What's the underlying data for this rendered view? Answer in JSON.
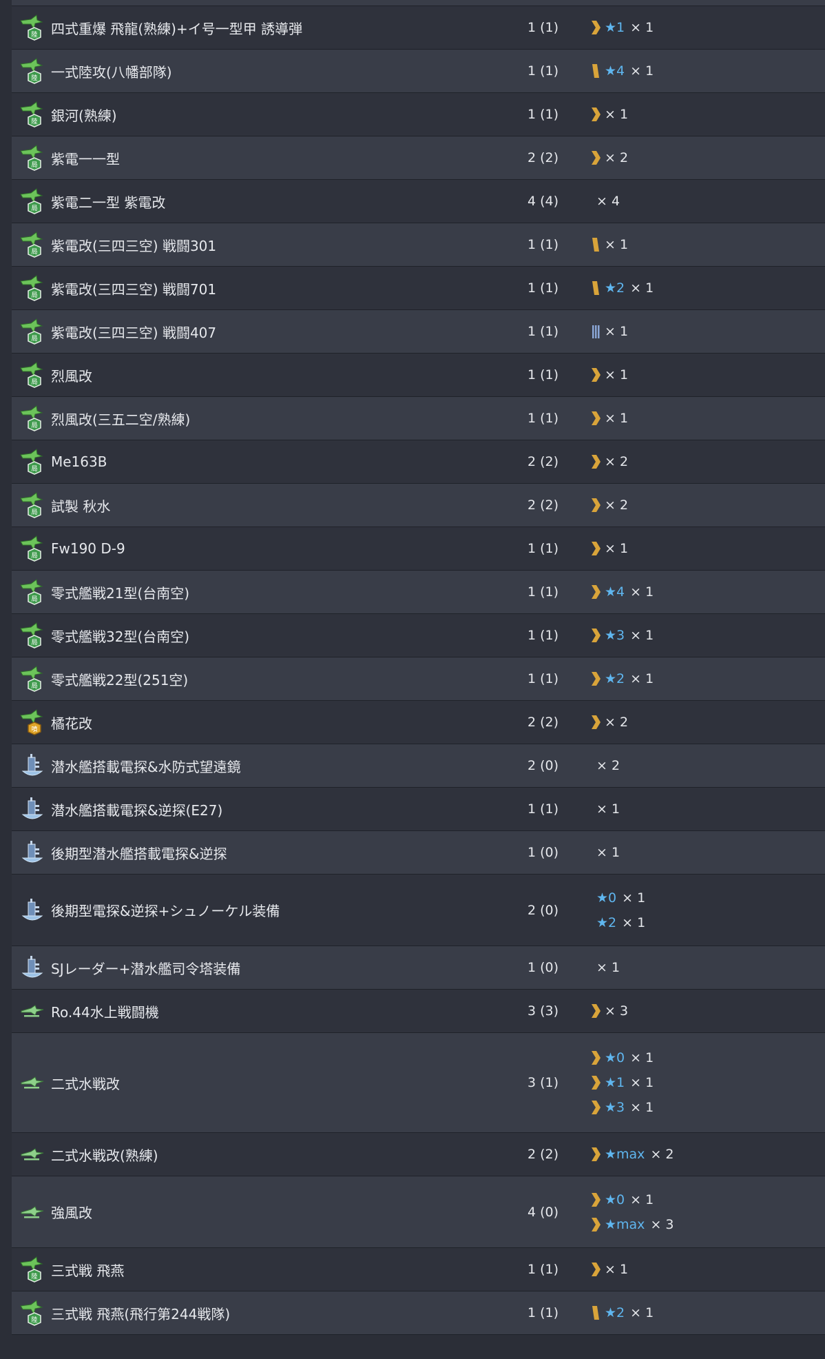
{
  "colors": {
    "row_odd": "#393d48",
    "row_even": "#2f323c",
    "star": "#5fb6ef",
    "proficiency_gold": "#d9a43a",
    "proficiency_blue": "#8aa6d6"
  },
  "rows": [
    {
      "name": "四式重爆 飛龍(熟練)+イ号一型甲 誘導弾",
      "icon": "land-attacker-icon",
      "count": "1 (1)",
      "prof": [
        {
          "icon": "proficiency-chevron-icon",
          "star": "★1",
          "qty": "× 1"
        }
      ]
    },
    {
      "name": "一式陸攻(八幡部隊)",
      "icon": "land-attacker-icon",
      "count": "1 (1)",
      "prof": [
        {
          "icon": "proficiency-bar-icon",
          "star": "★4",
          "qty": "× 1"
        }
      ]
    },
    {
      "name": "銀河(熟練)",
      "icon": "land-attacker-icon",
      "count": "1 (1)",
      "prof": [
        {
          "icon": "proficiency-chevron-icon",
          "star": "",
          "qty": "× 1"
        }
      ]
    },
    {
      "name": "紫電一一型",
      "icon": "interceptor-icon",
      "count": "2 (2)",
      "prof": [
        {
          "icon": "proficiency-chevron-icon",
          "star": "",
          "qty": "× 2"
        }
      ]
    },
    {
      "name": "紫電二一型 紫電改",
      "icon": "interceptor-icon",
      "count": "4 (4)",
      "prof": [
        {
          "icon": "none",
          "star": "",
          "qty": "× 4"
        }
      ]
    },
    {
      "name": "紫電改(三四三空) 戦闘301",
      "icon": "interceptor-icon",
      "count": "1 (1)",
      "prof": [
        {
          "icon": "proficiency-bar-icon",
          "star": "",
          "qty": "× 1"
        }
      ]
    },
    {
      "name": "紫電改(三四三空) 戦闘701",
      "icon": "interceptor-icon",
      "count": "1 (1)",
      "prof": [
        {
          "icon": "proficiency-bar-icon",
          "star": "★2",
          "qty": "× 1"
        }
      ]
    },
    {
      "name": "紫電改(三四三空) 戦闘407",
      "icon": "interceptor-icon",
      "count": "1 (1)",
      "prof": [
        {
          "icon": "proficiency-blue-bars-icon",
          "star": "",
          "qty": "× 1"
        }
      ]
    },
    {
      "name": "烈風改",
      "icon": "interceptor-icon",
      "count": "1 (1)",
      "prof": [
        {
          "icon": "proficiency-chevron-icon",
          "star": "",
          "qty": "× 1"
        }
      ]
    },
    {
      "name": "烈風改(三五二空/熟練)",
      "icon": "interceptor-icon",
      "count": "1 (1)",
      "prof": [
        {
          "icon": "proficiency-chevron-icon",
          "star": "",
          "qty": "× 1"
        }
      ]
    },
    {
      "name": "Me163B",
      "icon": "interceptor-icon",
      "count": "2 (2)",
      "prof": [
        {
          "icon": "proficiency-chevron-icon",
          "star": "",
          "qty": "× 2"
        }
      ]
    },
    {
      "name": "試製 秋水",
      "icon": "interceptor-icon",
      "count": "2 (2)",
      "prof": [
        {
          "icon": "proficiency-chevron-icon",
          "star": "",
          "qty": "× 2"
        }
      ]
    },
    {
      "name": "Fw190 D-9",
      "icon": "interceptor-icon",
      "count": "1 (1)",
      "prof": [
        {
          "icon": "proficiency-chevron-icon",
          "star": "",
          "qty": "× 1"
        }
      ]
    },
    {
      "name": "零式艦戦21型(台南空)",
      "icon": "interceptor-icon",
      "count": "1 (1)",
      "prof": [
        {
          "icon": "proficiency-chevron-icon",
          "star": "★4",
          "qty": "× 1"
        }
      ]
    },
    {
      "name": "零式艦戦32型(台南空)",
      "icon": "interceptor-icon",
      "count": "1 (1)",
      "prof": [
        {
          "icon": "proficiency-chevron-icon",
          "star": "★3",
          "qty": "× 1"
        }
      ]
    },
    {
      "name": "零式艦戦22型(251空)",
      "icon": "interceptor-icon",
      "count": "1 (1)",
      "prof": [
        {
          "icon": "proficiency-chevron-icon",
          "star": "★2",
          "qty": "× 1"
        }
      ]
    },
    {
      "name": "橘花改",
      "icon": "jet-bomber-icon",
      "count": "2 (2)",
      "prof": [
        {
          "icon": "proficiency-chevron-icon",
          "star": "",
          "qty": "× 2"
        }
      ]
    },
    {
      "name": "潜水艦搭載電探&水防式望遠鏡",
      "icon": "submarine-equipment-icon",
      "count": "2 (0)",
      "prof": [
        {
          "icon": "none",
          "star": "",
          "qty": "× 2"
        }
      ]
    },
    {
      "name": "潜水艦搭載電探&逆探(E27)",
      "icon": "submarine-equipment-icon",
      "count": "1 (1)",
      "prof": [
        {
          "icon": "none",
          "star": "",
          "qty": "× 1"
        }
      ]
    },
    {
      "name": "後期型潜水艦搭載電探&逆探",
      "icon": "submarine-equipment-icon",
      "count": "1 (0)",
      "prof": [
        {
          "icon": "none",
          "star": "",
          "qty": "× 1"
        }
      ]
    },
    {
      "name": "後期型電探&逆探+シュノーケル装備",
      "icon": "submarine-equipment-icon",
      "count": "2 (0)",
      "prof": [
        {
          "icon": "none",
          "star": "★0",
          "qty": "× 1"
        },
        {
          "icon": "none",
          "star": "★2",
          "qty": "× 1"
        }
      ]
    },
    {
      "name": "SJレーダー+潜水艦司令塔装備",
      "icon": "submarine-equipment-icon",
      "count": "1 (0)",
      "prof": [
        {
          "icon": "none",
          "star": "",
          "qty": "× 1"
        }
      ]
    },
    {
      "name": "Ro.44水上戦闘機",
      "icon": "seaplane-fighter-icon",
      "count": "3 (3)",
      "prof": [
        {
          "icon": "proficiency-chevron-icon",
          "star": "",
          "qty": "× 3"
        }
      ]
    },
    {
      "name": "二式水戦改",
      "icon": "seaplane-fighter-icon",
      "count": "3 (1)",
      "prof": [
        {
          "icon": "proficiency-chevron-icon",
          "star": "★0",
          "qty": "× 1"
        },
        {
          "icon": "proficiency-chevron-icon",
          "star": "★1",
          "qty": "× 1"
        },
        {
          "icon": "proficiency-chevron-icon",
          "star": "★3",
          "qty": "× 1"
        }
      ]
    },
    {
      "name": "二式水戦改(熟練)",
      "icon": "seaplane-fighter-icon",
      "count": "2 (2)",
      "prof": [
        {
          "icon": "proficiency-chevron-icon",
          "star": "★max",
          "qty": "× 2"
        }
      ]
    },
    {
      "name": "強風改",
      "icon": "seaplane-fighter-icon",
      "count": "4 (0)",
      "prof": [
        {
          "icon": "proficiency-chevron-icon",
          "star": "★0",
          "qty": "× 1"
        },
        {
          "icon": "proficiency-chevron-icon",
          "star": "★max",
          "qty": "× 3"
        }
      ]
    },
    {
      "name": "三式戦 飛燕",
      "icon": "army-fighter-icon",
      "count": "1 (1)",
      "prof": [
        {
          "icon": "proficiency-chevron-icon",
          "star": "",
          "qty": "× 1"
        }
      ]
    },
    {
      "name": "三式戦 飛燕(飛行第244戦隊)",
      "icon": "army-fighter-icon",
      "count": "1 (1)",
      "prof": [
        {
          "icon": "proficiency-bar-icon",
          "star": "★2",
          "qty": "× 1"
        }
      ]
    }
  ]
}
